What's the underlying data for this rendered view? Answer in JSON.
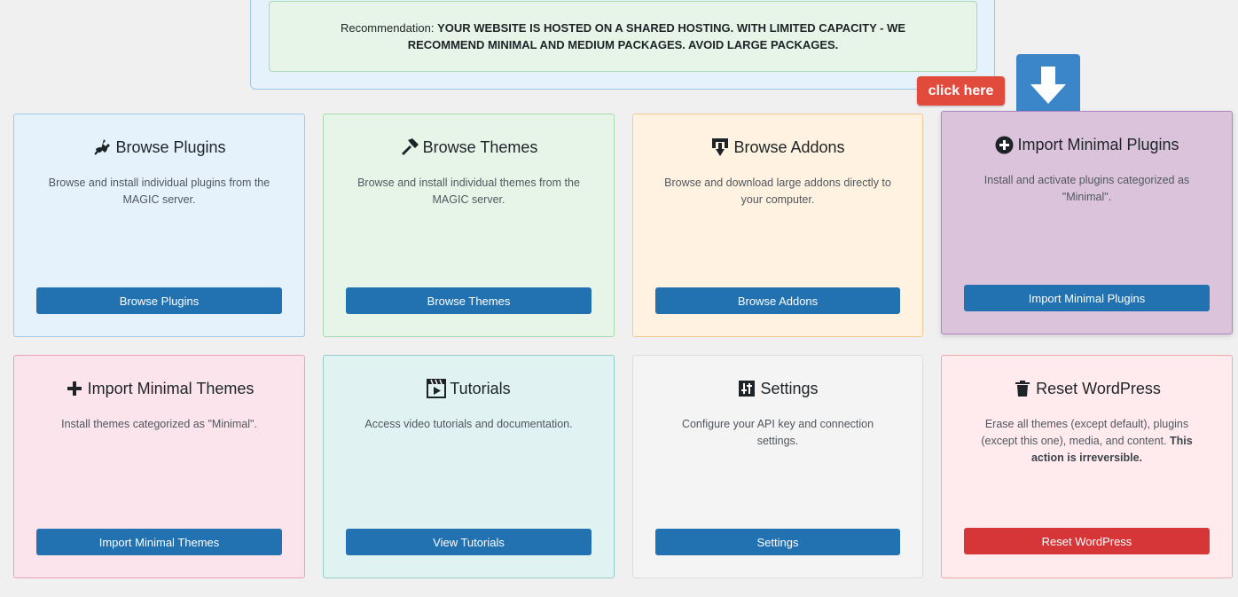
{
  "recommendation": {
    "label": "Recommendation:",
    "message": "YOUR WEBSITE IS HOSTED ON A SHARED HOSTING. WITH LIMITED CAPACITY - WE RECOMMEND MINIMAL AND MEDIUM PACKAGES. AVOID LARGE PACKAGES."
  },
  "callout": {
    "label": "click here",
    "icon": "arrow-down-icon",
    "color": "#e24a3b",
    "arrow_bg": "#3b86c9"
  },
  "cards": [
    {
      "title": "Browse Plugins",
      "icon": "plug-icon",
      "description": "Browse and install individual plugins from the MAGIC server.",
      "button": "Browse Plugins"
    },
    {
      "title": "Browse Themes",
      "icon": "hammer-icon",
      "description": "Browse and install individual themes from the MAGIC server.",
      "button": "Browse Themes"
    },
    {
      "title": "Browse Addons",
      "icon": "download-tray-icon",
      "description": "Browse and download large addons directly to your computer.",
      "button": "Browse Addons"
    },
    {
      "title": "Import Minimal Plugins",
      "icon": "plus-circle-icon",
      "description": "Install and activate plugins categorized as \"Minimal\".",
      "button": "Import Minimal Plugins"
    },
    {
      "title": "Import Minimal Themes",
      "icon": "plus-icon",
      "description": "Install themes categorized as \"Minimal\".",
      "button": "Import Minimal Themes"
    },
    {
      "title": "Tutorials",
      "icon": "video-icon",
      "description": "Access video tutorials and documentation.",
      "button": "View Tutorials"
    },
    {
      "title": "Settings",
      "icon": "sliders-icon",
      "description": "Configure your API key and connection settings.",
      "button": "Settings"
    },
    {
      "title": "Reset WordPress",
      "icon": "trash-icon",
      "description": "Erase all themes (except default), plugins (except this one), media, and content.",
      "description_bold": "This action is irreversible.",
      "button": "Reset WordPress"
    }
  ],
  "colors": {
    "button_primary": "#2271b1",
    "button_danger": "#d63638"
  }
}
